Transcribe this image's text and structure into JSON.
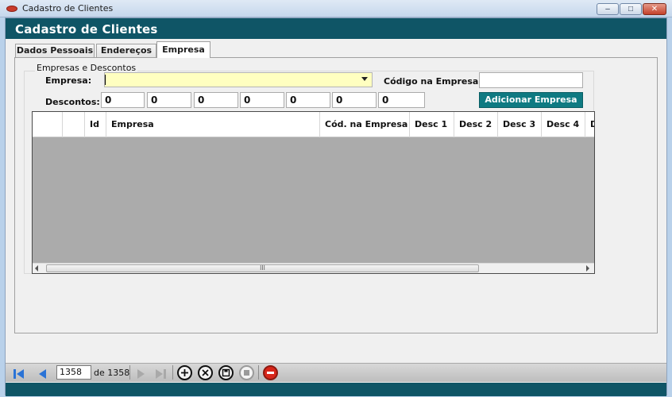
{
  "window": {
    "title": "Cadastro de Clientes",
    "minimize": "–",
    "maximize": "□",
    "close": "✕"
  },
  "header": {
    "title": "Cadastro de Clientes"
  },
  "tabs": [
    {
      "label": "Dados Pessoais",
      "active": false
    },
    {
      "label": "Endereços",
      "active": false
    },
    {
      "label": "Empresa",
      "active": true
    }
  ],
  "empresa_tab": {
    "group_title": "Empresas e Descontos",
    "empresa_label": "Empresa:",
    "empresa_value": "",
    "codigo_label": "Código na Empresa:",
    "codigo_value": "",
    "descontos_label": "Descontos:",
    "descontos": [
      "0",
      "0",
      "0",
      "0",
      "0",
      "0",
      "0"
    ],
    "add_button": "Adicionar Empresa"
  },
  "grid": {
    "columns": [
      "",
      "",
      "Id",
      "Empresa",
      "Cód. na Empresa",
      "Desc 1",
      "Desc 2",
      "Desc 3",
      "Desc 4",
      "D"
    ],
    "rows": [],
    "scroll_grip": "III"
  },
  "navigator": {
    "current": "1358",
    "total": "de 1358"
  },
  "colors": {
    "header": "#0f5566",
    "accent_button": "#0f7a82",
    "combo_bg": "#ffffc0",
    "grid_empty": "#ababab",
    "nav_blue": "#2a73d6",
    "delete_red": "#d8261a"
  }
}
